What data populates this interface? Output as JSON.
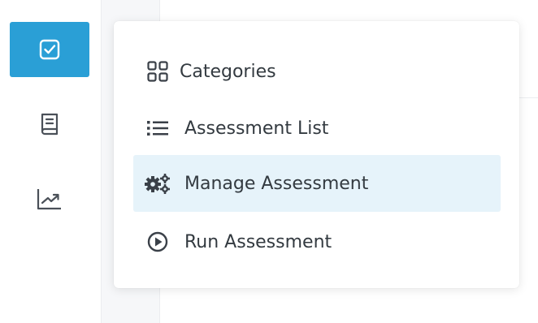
{
  "rail": {
    "items": [
      {
        "icon": "checkbox-square-icon",
        "active": true
      },
      {
        "icon": "book-icon",
        "active": false
      },
      {
        "icon": "line-chart-icon",
        "active": false
      }
    ],
    "accent_color": "#2a9fd6"
  },
  "menu": {
    "items": [
      {
        "label": "Categories",
        "icon": "grid-icon"
      },
      {
        "label": "Assessment List",
        "icon": "list-icon"
      },
      {
        "label": "Manage Assessment",
        "icon": "gears-icon",
        "highlighted": true
      },
      {
        "label": "Run Assessment",
        "icon": "play-circle-icon"
      }
    ],
    "highlight_color": "#e6f3fa"
  }
}
